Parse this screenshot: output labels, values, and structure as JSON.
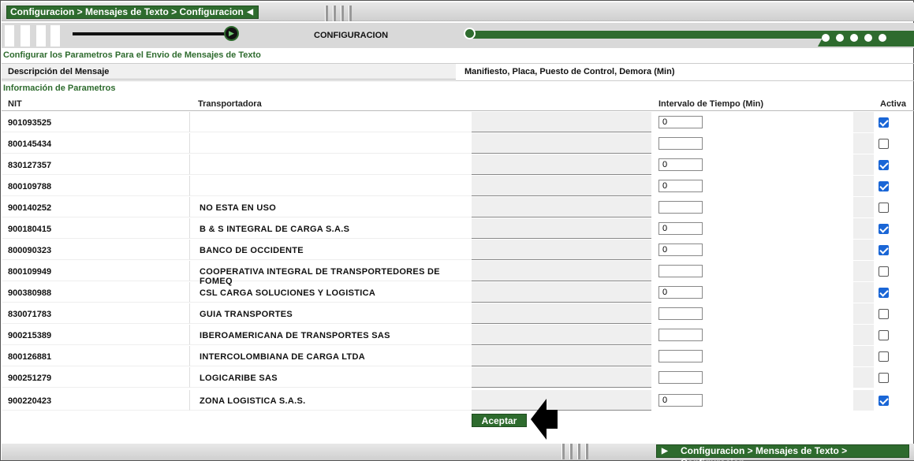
{
  "breadcrumb": "Configuracion > Mensajes de Texto > Configuracion",
  "page_title": "CONFIGURACION",
  "section_main": "Configurar los Parametros Para el Envio de Mensajes de Texto",
  "description": {
    "label": "Descripción del Mensaje",
    "value": "Manifiesto, Placa, Puesto de Control, Demora (Min)"
  },
  "section_params": "Información de Parametros",
  "columns": {
    "nit": "NIT",
    "transportadora": "Transportadora",
    "intervalo": "Intervalo de Tiempo (Min)",
    "activa": "Activa"
  },
  "rows": [
    {
      "nit": "901093525",
      "transportadora": "",
      "intervalo": "0",
      "activa": true
    },
    {
      "nit": "800145434",
      "transportadora": "",
      "intervalo": "",
      "activa": false
    },
    {
      "nit": "830127357",
      "transportadora": "",
      "intervalo": "0",
      "activa": true
    },
    {
      "nit": "800109788",
      "transportadora": "",
      "intervalo": "0",
      "activa": true
    },
    {
      "nit": "900140252",
      "transportadora": "NO ESTA EN USO",
      "intervalo": "",
      "activa": false
    },
    {
      "nit": "900180415",
      "transportadora": "B & S INTEGRAL DE CARGA S.A.S",
      "intervalo": "0",
      "activa": true
    },
    {
      "nit": "800090323",
      "transportadora": "BANCO DE OCCIDENTE",
      "intervalo": "0",
      "activa": true
    },
    {
      "nit": "800109949",
      "transportadora": "COOPERATIVA INTEGRAL DE TRANSPORTEDORES DE FOMEQ",
      "intervalo": "",
      "activa": false
    },
    {
      "nit": "900380988",
      "transportadora": "CSL CARGA SOLUCIONES Y LOGISTICA",
      "intervalo": "0",
      "activa": true
    },
    {
      "nit": "830071783",
      "transportadora": "GUIA TRANSPORTES",
      "intervalo": "",
      "activa": false
    },
    {
      "nit": "900215389",
      "transportadora": "IBEROAMERICANA DE TRANSPORTES SAS",
      "intervalo": "",
      "activa": false
    },
    {
      "nit": "800126881",
      "transportadora": "INTERCOLOMBIANA DE CARGA LTDA",
      "intervalo": "",
      "activa": false
    },
    {
      "nit": "900251279",
      "transportadora": "LOGICARIBE SAS",
      "intervalo": "",
      "activa": false
    },
    {
      "nit": "900220423",
      "transportadora": "ZONA LOGISTICA S.A.S.",
      "intervalo": "0",
      "activa": true
    }
  ],
  "accept_label": "Aceptar",
  "colors": {
    "brand_green": "#2e6b2e",
    "check_blue": "#1a66d6"
  },
  "icons": {
    "nav_arrow": "play-arrow-icon",
    "pointer": "pointing-arrow-icon"
  }
}
